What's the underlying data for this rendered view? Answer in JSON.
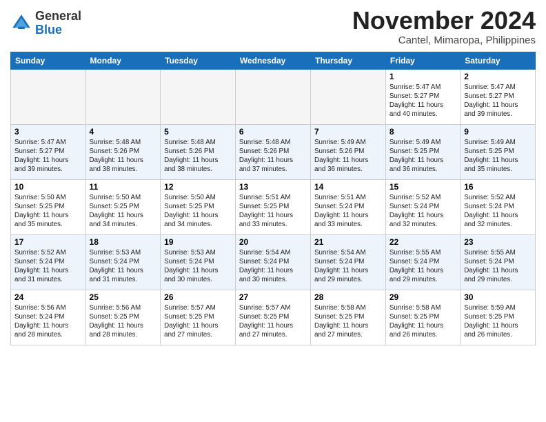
{
  "logo": {
    "general": "General",
    "blue": "Blue"
  },
  "title": "November 2024",
  "location": "Cantel, Mimaropa, Philippines",
  "weekdays": [
    "Sunday",
    "Monday",
    "Tuesday",
    "Wednesday",
    "Thursday",
    "Friday",
    "Saturday"
  ],
  "weeks": [
    [
      {
        "day": "",
        "info": ""
      },
      {
        "day": "",
        "info": ""
      },
      {
        "day": "",
        "info": ""
      },
      {
        "day": "",
        "info": ""
      },
      {
        "day": "",
        "info": ""
      },
      {
        "day": "1",
        "info": "Sunrise: 5:47 AM\nSunset: 5:27 PM\nDaylight: 11 hours\nand 40 minutes."
      },
      {
        "day": "2",
        "info": "Sunrise: 5:47 AM\nSunset: 5:27 PM\nDaylight: 11 hours\nand 39 minutes."
      }
    ],
    [
      {
        "day": "3",
        "info": "Sunrise: 5:47 AM\nSunset: 5:27 PM\nDaylight: 11 hours\nand 39 minutes."
      },
      {
        "day": "4",
        "info": "Sunrise: 5:48 AM\nSunset: 5:26 PM\nDaylight: 11 hours\nand 38 minutes."
      },
      {
        "day": "5",
        "info": "Sunrise: 5:48 AM\nSunset: 5:26 PM\nDaylight: 11 hours\nand 38 minutes."
      },
      {
        "day": "6",
        "info": "Sunrise: 5:48 AM\nSunset: 5:26 PM\nDaylight: 11 hours\nand 37 minutes."
      },
      {
        "day": "7",
        "info": "Sunrise: 5:49 AM\nSunset: 5:26 PM\nDaylight: 11 hours\nand 36 minutes."
      },
      {
        "day": "8",
        "info": "Sunrise: 5:49 AM\nSunset: 5:25 PM\nDaylight: 11 hours\nand 36 minutes."
      },
      {
        "day": "9",
        "info": "Sunrise: 5:49 AM\nSunset: 5:25 PM\nDaylight: 11 hours\nand 35 minutes."
      }
    ],
    [
      {
        "day": "10",
        "info": "Sunrise: 5:50 AM\nSunset: 5:25 PM\nDaylight: 11 hours\nand 35 minutes."
      },
      {
        "day": "11",
        "info": "Sunrise: 5:50 AM\nSunset: 5:25 PM\nDaylight: 11 hours\nand 34 minutes."
      },
      {
        "day": "12",
        "info": "Sunrise: 5:50 AM\nSunset: 5:25 PM\nDaylight: 11 hours\nand 34 minutes."
      },
      {
        "day": "13",
        "info": "Sunrise: 5:51 AM\nSunset: 5:25 PM\nDaylight: 11 hours\nand 33 minutes."
      },
      {
        "day": "14",
        "info": "Sunrise: 5:51 AM\nSunset: 5:24 PM\nDaylight: 11 hours\nand 33 minutes."
      },
      {
        "day": "15",
        "info": "Sunrise: 5:52 AM\nSunset: 5:24 PM\nDaylight: 11 hours\nand 32 minutes."
      },
      {
        "day": "16",
        "info": "Sunrise: 5:52 AM\nSunset: 5:24 PM\nDaylight: 11 hours\nand 32 minutes."
      }
    ],
    [
      {
        "day": "17",
        "info": "Sunrise: 5:52 AM\nSunset: 5:24 PM\nDaylight: 11 hours\nand 31 minutes."
      },
      {
        "day": "18",
        "info": "Sunrise: 5:53 AM\nSunset: 5:24 PM\nDaylight: 11 hours\nand 31 minutes."
      },
      {
        "day": "19",
        "info": "Sunrise: 5:53 AM\nSunset: 5:24 PM\nDaylight: 11 hours\nand 30 minutes."
      },
      {
        "day": "20",
        "info": "Sunrise: 5:54 AM\nSunset: 5:24 PM\nDaylight: 11 hours\nand 30 minutes."
      },
      {
        "day": "21",
        "info": "Sunrise: 5:54 AM\nSunset: 5:24 PM\nDaylight: 11 hours\nand 29 minutes."
      },
      {
        "day": "22",
        "info": "Sunrise: 5:55 AM\nSunset: 5:24 PM\nDaylight: 11 hours\nand 29 minutes."
      },
      {
        "day": "23",
        "info": "Sunrise: 5:55 AM\nSunset: 5:24 PM\nDaylight: 11 hours\nand 29 minutes."
      }
    ],
    [
      {
        "day": "24",
        "info": "Sunrise: 5:56 AM\nSunset: 5:24 PM\nDaylight: 11 hours\nand 28 minutes."
      },
      {
        "day": "25",
        "info": "Sunrise: 5:56 AM\nSunset: 5:25 PM\nDaylight: 11 hours\nand 28 minutes."
      },
      {
        "day": "26",
        "info": "Sunrise: 5:57 AM\nSunset: 5:25 PM\nDaylight: 11 hours\nand 27 minutes."
      },
      {
        "day": "27",
        "info": "Sunrise: 5:57 AM\nSunset: 5:25 PM\nDaylight: 11 hours\nand 27 minutes."
      },
      {
        "day": "28",
        "info": "Sunrise: 5:58 AM\nSunset: 5:25 PM\nDaylight: 11 hours\nand 27 minutes."
      },
      {
        "day": "29",
        "info": "Sunrise: 5:58 AM\nSunset: 5:25 PM\nDaylight: 11 hours\nand 26 minutes."
      },
      {
        "day": "30",
        "info": "Sunrise: 5:59 AM\nSunset: 5:25 PM\nDaylight: 11 hours\nand 26 minutes."
      }
    ]
  ]
}
